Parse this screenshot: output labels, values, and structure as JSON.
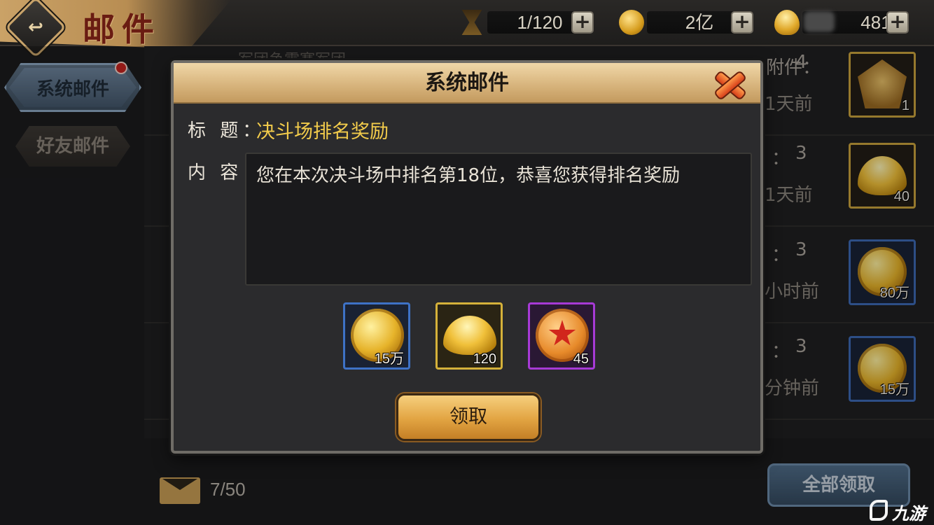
{
  "header": {
    "title": "邮件",
    "back_icon": "back-arrow-icon"
  },
  "resources": [
    {
      "name": "stamina",
      "icon": "hourglass-icon",
      "value": "1/120"
    },
    {
      "name": "coins",
      "icon": "coin-icon",
      "value": "2亿"
    },
    {
      "name": "ingots",
      "icon": "ingot-icon",
      "value": "481"
    }
  ],
  "tabs": [
    {
      "label": "系统邮件",
      "active": true,
      "has_notification": true
    },
    {
      "label": "好友邮件",
      "active": false
    }
  ],
  "mail_list": {
    "ghost_text": "军团争霸赛军团",
    "rows": [
      {
        "attachment_label": "附件：",
        "attachment_count": "4",
        "time": "1天前",
        "item": "title-badge",
        "item_count": "1",
        "frame": "gold"
      },
      {
        "attachment_label": "：",
        "attachment_count": "3",
        "time": "1天前",
        "item": "ingot",
        "item_count": "40",
        "frame": "gold"
      },
      {
        "attachment_label": "：",
        "attachment_count": "3",
        "time": "小时前",
        "item": "coin",
        "item_count": "80万",
        "frame": "blue"
      },
      {
        "attachment_label": "：",
        "attachment_count": "3",
        "time": "分钟前",
        "item": "coin",
        "item_count": "15万",
        "frame": "blue"
      }
    ]
  },
  "footer": {
    "mail_count": "7/50",
    "claim_all_label": "全部领取"
  },
  "dialog": {
    "title": "系统邮件",
    "subject_label": "标 题：",
    "subject": "决斗场排名奖励",
    "content_label": "内 容：",
    "content": "您在本次决斗场中排名第18位，恭喜您获得排名奖励",
    "rewards": [
      {
        "item": "coin",
        "count": "15万",
        "frame": "blue"
      },
      {
        "item": "ingot",
        "count": "120",
        "frame": "gold"
      },
      {
        "item": "star-medal",
        "count": "45",
        "frame": "purple"
      }
    ],
    "claim_label": "领取"
  },
  "watermark": {
    "text": "九游"
  },
  "colors": {
    "accent_gold": "#f3cc4b",
    "dialog_header": "#d6b27a",
    "claim_button": "#e2a442",
    "tab_active": "#5c6f82",
    "notification_dot": "#c4231f"
  }
}
